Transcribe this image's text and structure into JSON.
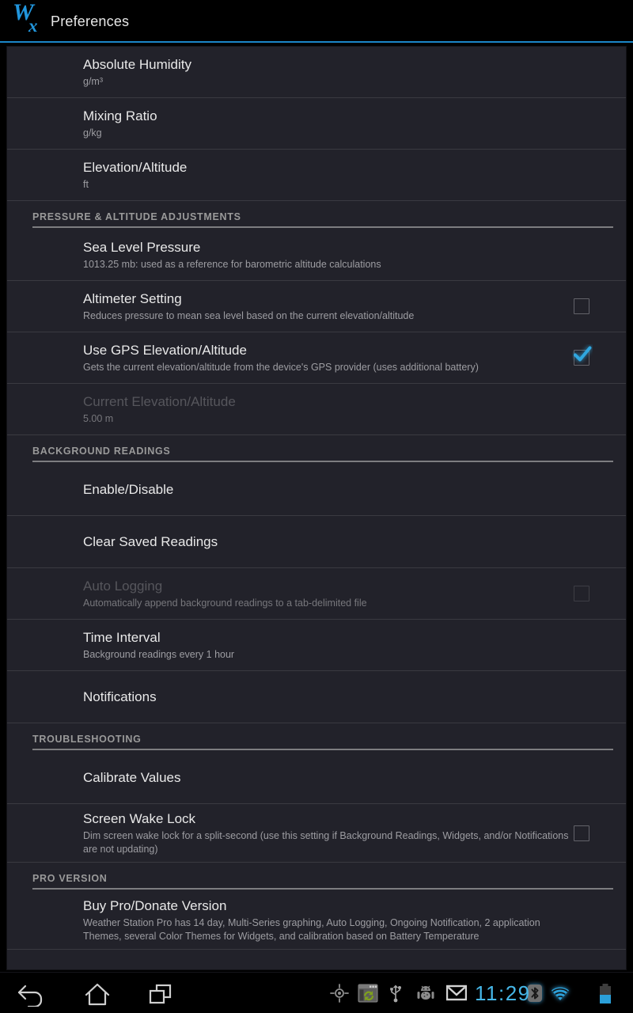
{
  "app": {
    "logo_w": "W",
    "logo_x": "x",
    "title": "Preferences",
    "accent_color": "#1b86c8",
    "panel_bg": "#22222a"
  },
  "preferences": [
    {
      "kind": "pref",
      "name": "absolute-humidity",
      "title": "Absolute Humidity",
      "summary": "g/m³",
      "widget": "none",
      "disabled": false
    },
    {
      "kind": "pref",
      "name": "mixing-ratio",
      "title": "Mixing Ratio",
      "summary": "g/kg",
      "widget": "none",
      "disabled": false
    },
    {
      "kind": "pref",
      "name": "elevation-altitude",
      "title": "Elevation/Altitude",
      "summary": "ft",
      "widget": "none",
      "disabled": false
    },
    {
      "kind": "section",
      "name": "pressure-altitude-adjustments",
      "title": "PRESSURE & ALTITUDE ADJUSTMENTS"
    },
    {
      "kind": "pref",
      "name": "sea-level-pressure",
      "title": "Sea Level Pressure",
      "summary": "1013.25 mb: used as a reference for barometric altitude calculations",
      "widget": "none",
      "disabled": false
    },
    {
      "kind": "pref",
      "name": "altimeter-setting",
      "title": "Altimeter Setting",
      "summary": "Reduces pressure to mean sea level based on the current elevation/altitude",
      "widget": "checkbox",
      "checked": false,
      "disabled": false
    },
    {
      "kind": "pref",
      "name": "use-gps-elevation-altitude",
      "title": "Use GPS Elevation/Altitude",
      "summary": "Gets the current elevation/altitude from the device's GPS provider (uses additional battery)",
      "widget": "checkbox",
      "checked": true,
      "disabled": false
    },
    {
      "kind": "pref",
      "name": "current-elevation-altitude",
      "title": "Current Elevation/Altitude",
      "summary": "5.00 m",
      "widget": "none",
      "disabled": true
    },
    {
      "kind": "section",
      "name": "background-readings",
      "title": "BACKGROUND READINGS"
    },
    {
      "kind": "pref",
      "name": "enable-disable",
      "title": "Enable/Disable",
      "summary": "",
      "widget": "none",
      "disabled": false
    },
    {
      "kind": "pref",
      "name": "clear-saved-readings",
      "title": "Clear Saved Readings",
      "summary": "",
      "widget": "none",
      "disabled": false
    },
    {
      "kind": "pref",
      "name": "auto-logging",
      "title": "Auto Logging",
      "summary": "Automatically append background readings to a tab-delimited file",
      "widget": "checkbox",
      "checked": false,
      "disabled": true
    },
    {
      "kind": "pref",
      "name": "time-interval",
      "title": "Time Interval",
      "summary": "Background readings every 1 hour",
      "widget": "none",
      "disabled": false
    },
    {
      "kind": "pref",
      "name": "notifications",
      "title": "Notifications",
      "summary": "",
      "widget": "none",
      "disabled": false
    },
    {
      "kind": "section",
      "name": "troubleshooting",
      "title": "TROUBLESHOOTING"
    },
    {
      "kind": "pref",
      "name": "calibrate-values",
      "title": "Calibrate Values",
      "summary": "",
      "widget": "none",
      "disabled": false
    },
    {
      "kind": "pref",
      "name": "screen-wake-lock",
      "title": "Screen Wake Lock",
      "summary": "Dim screen wake lock for a split-second (use this setting if Background Readings, Widgets, and/or Notifications are not updating)",
      "widget": "checkbox",
      "checked": false,
      "disabled": false
    },
    {
      "kind": "section",
      "name": "pro-version",
      "title": "PRO VERSION"
    },
    {
      "kind": "pref",
      "name": "buy-pro-donate-version",
      "title": "Buy Pro/Donate Version",
      "summary": "Weather Station Pro has 14 day, Multi-Series graphing, Auto Logging, Ongoing Notification, 2 application Themes, several Color Themes for Widgets, and calibration based on Battery Temperature",
      "widget": "none",
      "disabled": false
    }
  ],
  "navbar": {
    "buttons": [
      {
        "name": "back-icon",
        "label": "Back"
      },
      {
        "name": "home-icon",
        "label": "Home"
      },
      {
        "name": "recent-apps-icon",
        "label": "Recent apps"
      }
    ],
    "status_icons": [
      {
        "name": "gps-location-icon",
        "label": "GPS active"
      },
      {
        "name": "screen-recorder-sync-icon",
        "label": "Screen capture sync"
      },
      {
        "name": "usb-icon",
        "label": "USB connected"
      },
      {
        "name": "android-debug-icon",
        "label": "USB debugging"
      },
      {
        "name": "gmail-icon",
        "label": "Gmail"
      },
      {
        "name": "bluetooth-icon",
        "label": "Bluetooth"
      },
      {
        "name": "wifi-icon",
        "label": "Wi-Fi"
      },
      {
        "name": "battery-icon",
        "label": "Battery"
      }
    ],
    "clock": "11:29",
    "clock_color": "#46b7e8"
  }
}
